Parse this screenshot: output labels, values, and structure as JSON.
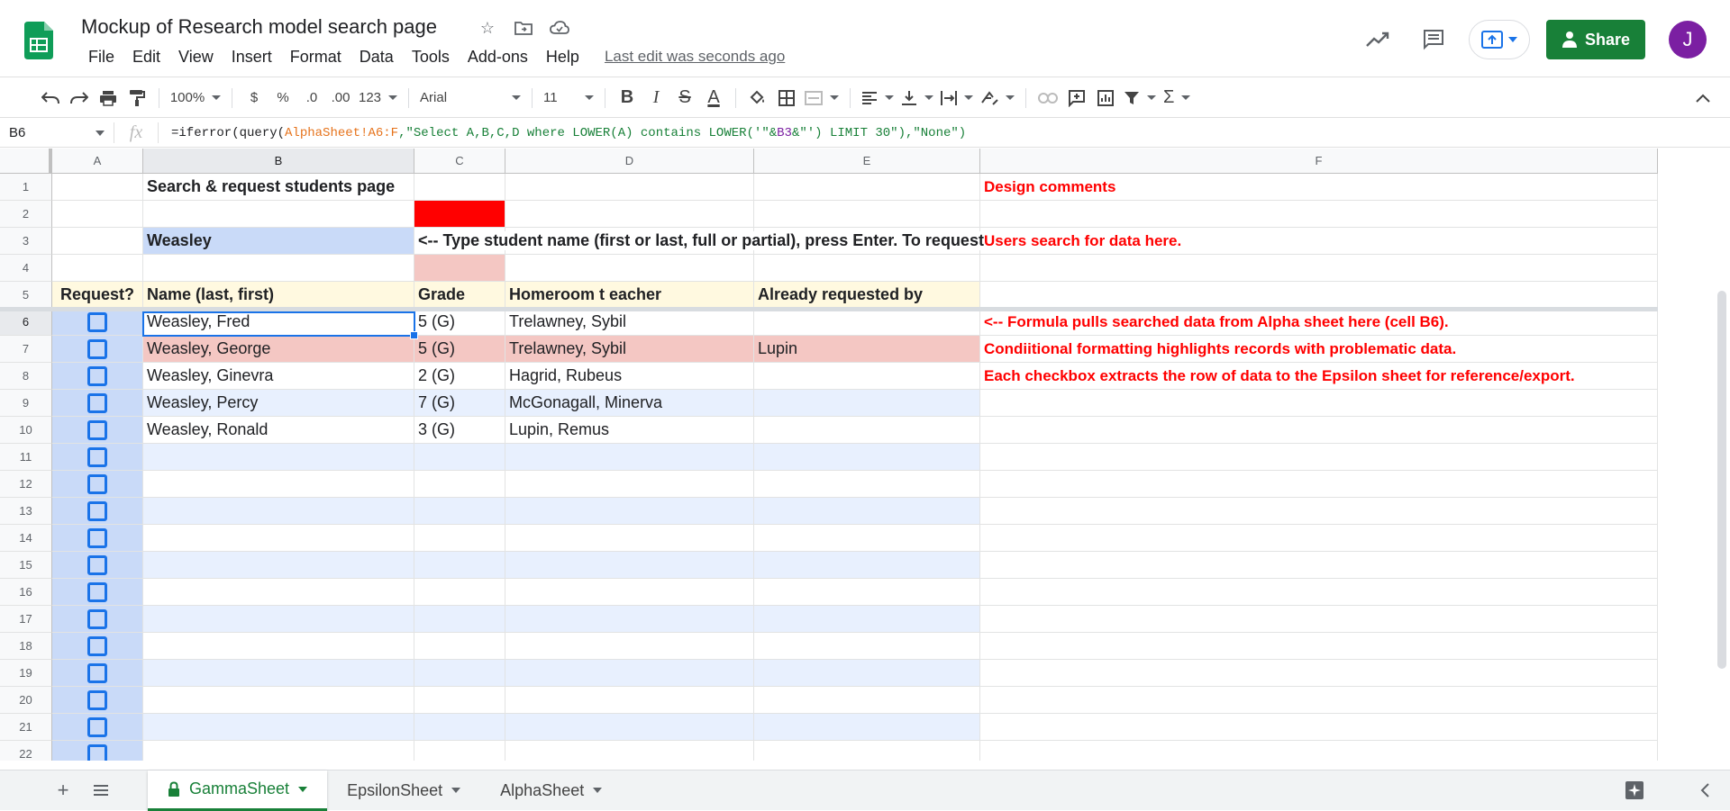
{
  "app": {
    "doc_title": "Mockup of Research model search page",
    "menu": [
      "File",
      "Edit",
      "View",
      "Insert",
      "Format",
      "Data",
      "Tools",
      "Add-ons",
      "Help"
    ],
    "last_edit": "Last edit was seconds ago",
    "share_label": "Share",
    "avatar_initial": "J"
  },
  "toolbar": {
    "zoom": "100%",
    "currency": "$",
    "percent": "%",
    "dec_less": ".0",
    "dec_more": ".00",
    "number_format": "123",
    "font": "Arial",
    "font_size": "11",
    "bold": "B",
    "italic": "I",
    "strike": "S",
    "text_color": "A",
    "sum": "Σ"
  },
  "formula_bar": {
    "cell_ref": "B6",
    "fx": "fx",
    "formula_parts": [
      "=iferror(query(",
      "AlphaSheet!A6:F",
      ",\"Select A,B,C,D where LOWER(A) contains LOWER('\"&",
      "B3",
      "&\"') LIMIT 30\"),\"None\")"
    ]
  },
  "columns": [
    "A",
    "B",
    "C",
    "D",
    "E",
    "F"
  ],
  "rows": [
    {
      "num": "1",
      "A": "",
      "B": "Search & request students page",
      "C": "",
      "D": "",
      "E": "",
      "F": "Design comments"
    },
    {
      "num": "2",
      "A": "",
      "B": "",
      "C": "",
      "D": "",
      "E": "",
      "F": ""
    },
    {
      "num": "3",
      "A": "",
      "B": "Weasley",
      "C": "<-- Type student name (first or last, full or partial), press Enter. To request",
      "D": "",
      "E": "",
      "F": "Users search for data here."
    },
    {
      "num": "4",
      "A": "",
      "B": "",
      "C": "",
      "D": "",
      "E": "",
      "F": ""
    },
    {
      "num": "5",
      "A": "Request?",
      "B": "Name (last, first)",
      "C": "Grade",
      "D": "Homeroom t eacher",
      "E": "Already requested by",
      "F": ""
    },
    {
      "num": "6",
      "A": "",
      "B": "Weasley, Fred",
      "C": "5 (G)",
      "D": "Trelawney, Sybil",
      "E": "",
      "F": "<-- Formula pulls searched data from Alpha sheet here (cell B6)."
    },
    {
      "num": "7",
      "A": "",
      "B": "Weasley, George",
      "C": "5 (G)",
      "D": "Trelawney, Sybil",
      "E": "Lupin",
      "F": "Condiitional formatting highlights records with problematic data."
    },
    {
      "num": "8",
      "A": "",
      "B": "Weasley, Ginevra",
      "C": "2 (G)",
      "D": "Hagrid, Rubeus",
      "E": "",
      "F": "Each checkbox extracts the row of data to the Epsilon sheet for reference/export."
    },
    {
      "num": "9",
      "A": "",
      "B": "Weasley, Percy",
      "C": "7 (G)",
      "D": "McGonagall, Minerva",
      "E": "",
      "F": ""
    },
    {
      "num": "10",
      "A": "",
      "B": "Weasley, Ronald",
      "C": "3 (G)",
      "D": "Lupin, Remus",
      "E": "",
      "F": ""
    },
    {
      "num": "11",
      "A": "",
      "B": "",
      "C": "",
      "D": "",
      "E": "",
      "F": ""
    },
    {
      "num": "12",
      "A": "",
      "B": "",
      "C": "",
      "D": "",
      "E": "",
      "F": ""
    },
    {
      "num": "13",
      "A": "",
      "B": "",
      "C": "",
      "D": "",
      "E": "",
      "F": ""
    },
    {
      "num": "14",
      "A": "",
      "B": "",
      "C": "",
      "D": "",
      "E": "",
      "F": ""
    },
    {
      "num": "15",
      "A": "",
      "B": "",
      "C": "",
      "D": "",
      "E": "",
      "F": ""
    },
    {
      "num": "16",
      "A": "",
      "B": "",
      "C": "",
      "D": "",
      "E": "",
      "F": ""
    },
    {
      "num": "17",
      "A": "",
      "B": "",
      "C": "",
      "D": "",
      "E": "",
      "F": ""
    },
    {
      "num": "18",
      "A": "",
      "B": "",
      "C": "",
      "D": "",
      "E": "",
      "F": ""
    },
    {
      "num": "19",
      "A": "",
      "B": "",
      "C": "",
      "D": "",
      "E": "",
      "F": ""
    },
    {
      "num": "20",
      "A": "",
      "B": "",
      "C": "",
      "D": "",
      "E": "",
      "F": ""
    },
    {
      "num": "21",
      "A": "",
      "B": "",
      "C": "",
      "D": "",
      "E": "",
      "F": ""
    },
    {
      "num": "22",
      "A": "",
      "B": "",
      "C": "",
      "D": "",
      "E": "",
      "F": ""
    }
  ],
  "sheets": [
    {
      "name": "GammaSheet",
      "active": true,
      "locked": true
    },
    {
      "name": "EpsilonSheet",
      "active": false,
      "locked": false
    },
    {
      "name": "AlphaSheet",
      "active": false,
      "locked": false
    }
  ],
  "colors": {
    "accent": "#1a73e8",
    "share_green": "#188038",
    "comment_red": "#ff0000",
    "search_blue": "#c9daf8",
    "header_yellow": "#fff9e0",
    "problem_pink": "#f4c7c3",
    "band_blue": "#e8f0fe"
  }
}
